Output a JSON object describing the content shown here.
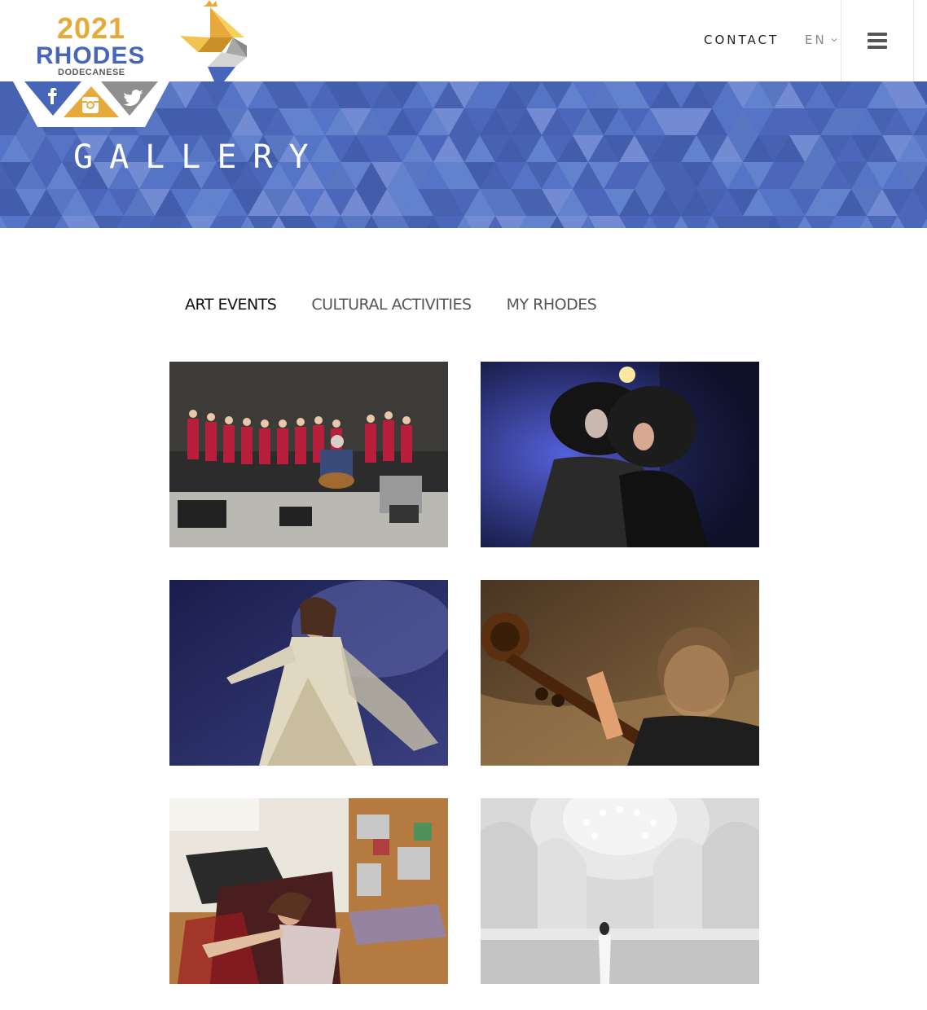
{
  "header": {
    "logo": {
      "year": "2021",
      "name": "RHODES",
      "sub": "DODECANESE"
    },
    "nav_contact": "CONTACT",
    "language": "EN",
    "menu_icon": "hamburger-menu-icon"
  },
  "social": {
    "icons": [
      "facebook-icon",
      "instagram-icon",
      "twitter-icon"
    ],
    "colors": {
      "left": "#4866b8",
      "middle": "#e7a93a",
      "right": "#8f8f8f"
    }
  },
  "banner": {
    "title": "GALLERY",
    "color": "#5470c0"
  },
  "tabs": [
    {
      "label": "ART EVENTS",
      "active": true
    },
    {
      "label": "CULTURAL ACTIVITIES",
      "active": false
    },
    {
      "label": "MY RHODES",
      "active": false
    }
  ],
  "gallery": {
    "photos": [
      {
        "subject": "choir-concert"
      },
      {
        "subject": "theatre-performers"
      },
      {
        "subject": "dancer-in-white"
      },
      {
        "subject": "cellist"
      },
      {
        "subject": "performer-on-floor"
      },
      {
        "subject": "white-domed-interior"
      }
    ]
  }
}
